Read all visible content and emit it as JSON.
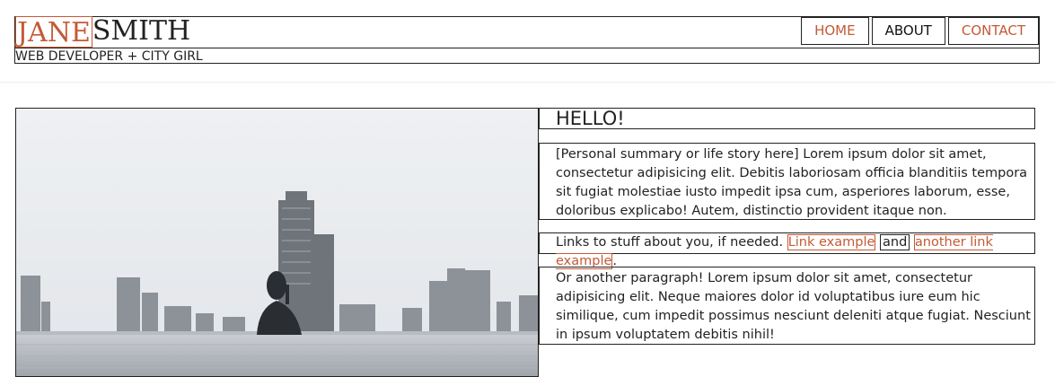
{
  "header": {
    "logo_first": "JANE",
    "logo_last": "SMITH",
    "tagline": "WEB DEVELOPER + CITY GIRL"
  },
  "nav": {
    "items": [
      {
        "label": "HOME"
      },
      {
        "label": "ABOUT"
      },
      {
        "label": "CONTACT"
      }
    ]
  },
  "main": {
    "heading": "HELLO!",
    "paragraph1": "[Personal summary or life story here] Lorem ipsum dolor sit amet, consectetur adipisicing elit. Debitis laboriosam officia blanditiis tempora sit fugiat molestiae iusto impedit ipsa cum, asperiores laborum, esse, doloribus explicabo! Autem, distinctio provident itaque non.",
    "links_intro": "Links to stuff about you, if needed.",
    "link1": "Link example",
    "and_text": "and",
    "link2": "another link example",
    "period": ".",
    "paragraph3": "Or another paragraph! Lorem ipsum dolor sit amet, consectetur adipisicing elit. Neque maiores dolor id voluptatibus iure eum hic similique, cum impedit possimus nesciunt deleniti atque fugiat. Nesciunt in ipsum voluptatem debitis nihil!"
  },
  "colors": {
    "accent": "#c45a36",
    "text": "#222222",
    "border": "#222222"
  }
}
